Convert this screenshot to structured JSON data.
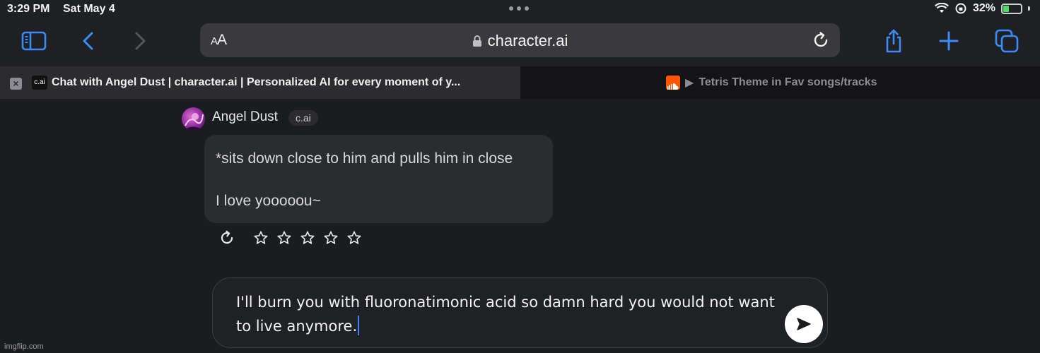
{
  "status_bar": {
    "time": "3:29 PM",
    "date": "Sat May 4",
    "battery_percent_label": "32%",
    "battery_level": 0.32
  },
  "toolbar": {
    "text_size_label_small": "A",
    "text_size_label_large": "A",
    "url": "character.ai",
    "accent_color": "#3a8cf6"
  },
  "tabs": [
    {
      "favicon_text": "c.ai",
      "title": "Chat with Angel Dust | character.ai | Personalized AI for every moment of y...",
      "active": true
    },
    {
      "title": "Tetris Theme in Fav songs/tracks",
      "playing_glyph": "▶",
      "active": false
    }
  ],
  "chat": {
    "character_name": "Angel Dust",
    "badge": "c.ai",
    "message_lines": [
      "*sits down close to him and pulls him in close",
      "I love yooooou~"
    ],
    "rating_stars": 0,
    "rating_max": 5,
    "input_value": "I'll burn you with fluoronatimonic acid so damn hard you would not want to live anymore."
  },
  "watermark": "imgflip.com"
}
